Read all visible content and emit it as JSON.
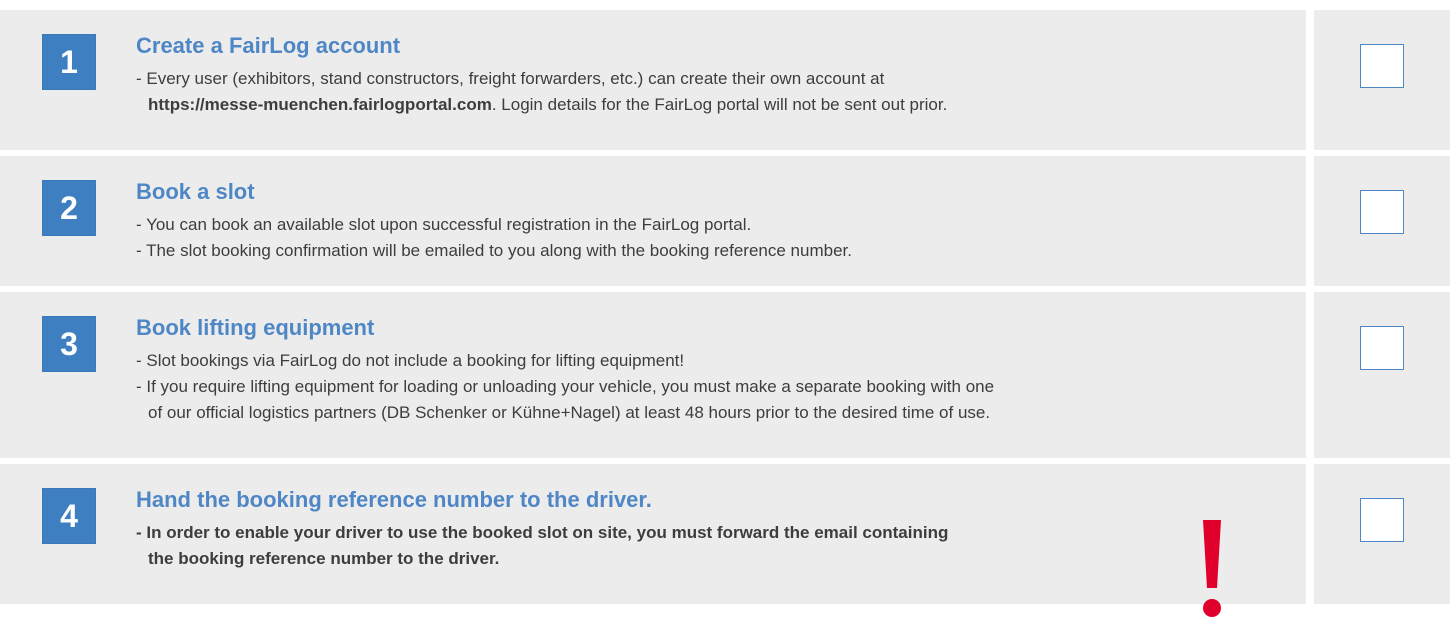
{
  "steps": [
    {
      "number": "1",
      "title": "Create a FairLog account",
      "lines": [
        "- Every user (exhibitors, stand constructors, freight forwarders, etc.) can create their own account at"
      ],
      "url": "https://messe-muenchen.fairlogportal.com",
      "url_suffix": ". Login details for the FairLog portal will not be sent out prior."
    },
    {
      "number": "2",
      "title": "Book a slot",
      "lines": [
        "- You can book an available slot upon successful registration in the FairLog portal.",
        "- The slot booking confirmation will be emailed to you along with the booking reference number."
      ]
    },
    {
      "number": "3",
      "title": "Book lifting equipment",
      "lines": [
        "- Slot bookings via FairLog do not include a booking for lifting equipment!",
        "- If you require lifting equipment for loading or unloading your vehicle, you must make a separate booking with one",
        "of our official logistics partners (DB Schenker or Kühne+Nagel) at least 48 hours prior to the desired time of use."
      ]
    },
    {
      "number": "4",
      "title": "Hand the booking reference number to the driver.",
      "lines": [
        "- In order to enable your driver to use the booked slot on site, you must forward the email containing",
        "the booking reference number to the driver."
      ]
    }
  ],
  "colors": {
    "accent": "#3e7fc1",
    "title": "#4f87c6",
    "panel": "#ececec",
    "warning": "#e0002b"
  },
  "icons": {
    "warning": "exclamation-icon"
  }
}
